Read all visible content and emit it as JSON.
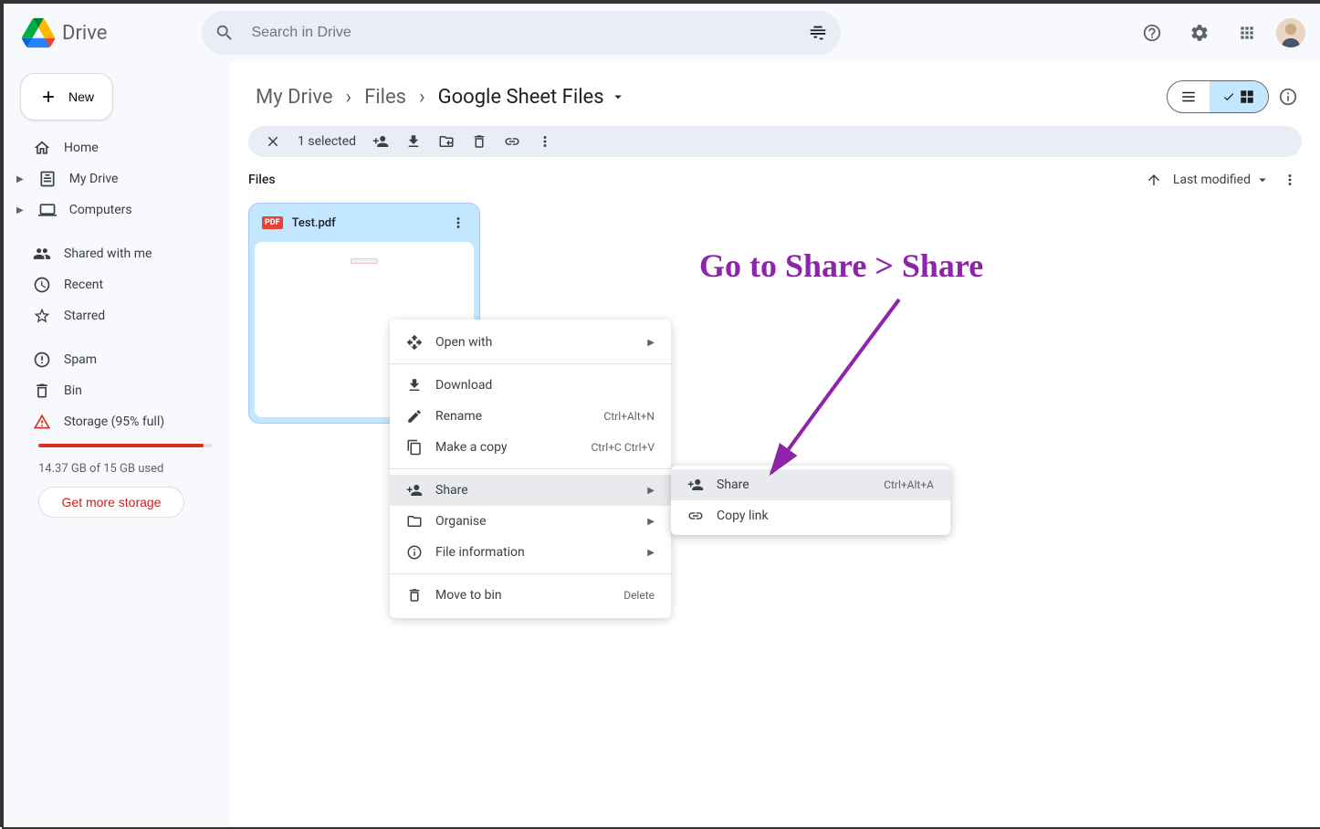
{
  "app": {
    "name": "Drive"
  },
  "search": {
    "placeholder": "Search in Drive"
  },
  "new_label": "New",
  "sidebar": {
    "items": [
      {
        "label": "Home"
      },
      {
        "label": "My Drive"
      },
      {
        "label": "Computers"
      },
      {
        "label": "Shared with me"
      },
      {
        "label": "Recent"
      },
      {
        "label": "Starred"
      },
      {
        "label": "Spam"
      },
      {
        "label": "Bin"
      },
      {
        "label": "Storage (95% full)"
      }
    ],
    "storage_used": "14.37 GB of 15 GB used",
    "get_storage": "Get more storage"
  },
  "breadcrumbs": [
    "My Drive",
    "Files",
    "Google Sheet Files"
  ],
  "selection_bar": {
    "count": "1 selected"
  },
  "files_section": "Files",
  "sort": {
    "label": "Last modified"
  },
  "file": {
    "name": "Test.pdf",
    "badge": "PDF"
  },
  "context_menu": {
    "open_with": "Open with",
    "download": "Download",
    "rename": "Rename",
    "rename_sc": "Ctrl+Alt+N",
    "make_copy": "Make a copy",
    "make_copy_sc": "Ctrl+C Ctrl+V",
    "share": "Share",
    "organise": "Organise",
    "file_info": "File information",
    "move_to_bin": "Move to bin",
    "delete": "Delete"
  },
  "share_submenu": {
    "share": "Share",
    "share_sc": "Ctrl+Alt+A",
    "copy_link": "Copy link"
  },
  "annotation": "Go to Share > Share"
}
